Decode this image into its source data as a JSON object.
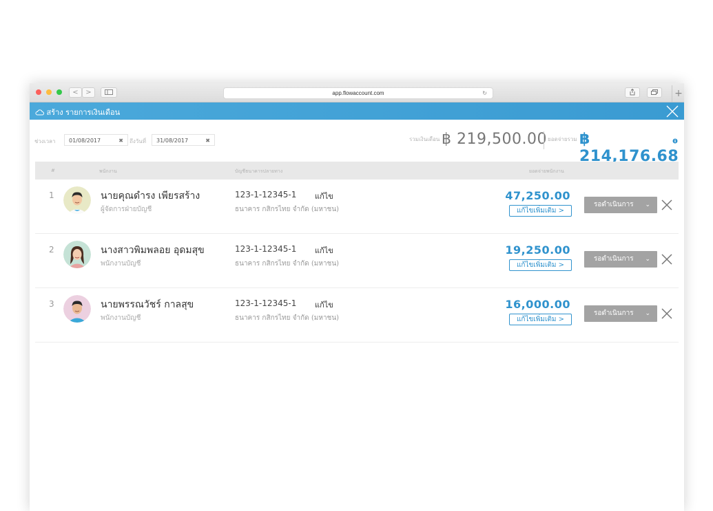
{
  "browser": {
    "url": "app.flowaccount.com",
    "nav_back": "<",
    "nav_forward": ">",
    "colors": {
      "close": "#fc605c",
      "minimize": "#fdbc40",
      "maximize": "#34c84a"
    }
  },
  "app": {
    "title": "สร้าง รายการเงินเดือน"
  },
  "filters": {
    "period_label": "ช่วงเวลา",
    "start_date": "01/08/2017",
    "to_label": "ถึงวันที่",
    "end_date": "31/08/2017"
  },
  "summary": {
    "total_salary_label": "รวมเงินเดือน",
    "total_salary": "฿ 219,500.00",
    "total_pay_label": "ยอดจ่ายรวม",
    "total_pay": "฿ 214,176.68"
  },
  "table": {
    "headers": [
      "#",
      "พนักงาน",
      "บัญชีธนาคารปลายทาง",
      "ยอดจ่ายพนักงาน"
    ],
    "rows": [
      {
        "num": "1",
        "name": "นายคุณดำรง เพียรสร้าง",
        "position": "ผู้จัดการฝ่ายบัญชี",
        "account": "123-1-12345-1",
        "edit": "แก้ไข",
        "bank": "ธนาคาร กสิกรไทย จำกัด (มหาชน)",
        "amount": "47,250.00",
        "more": "แก้ไขเพิ่มเติม >",
        "status": "รอดำเนินการ"
      },
      {
        "num": "2",
        "name": "นางสาวพิมพลอย อุดมสุข",
        "position": "พนักงานบัญชี",
        "account": "123-1-12345-1",
        "edit": "แก้ไข",
        "bank": "ธนาคาร กสิกรไทย จำกัด (มหาชน)",
        "amount": "19,250.00",
        "more": "แก้ไขเพิ่มเติม >",
        "status": "รอดำเนินการ"
      },
      {
        "num": "3",
        "name": "นายพรรณวัชร์ กาลสุข",
        "position": "พนักงานบัญชี",
        "account": "123-1-12345-1",
        "edit": "แก้ไข",
        "bank": "ธนาคาร กสิกรไทย จำกัด (มหาชน)",
        "amount": "16,000.00",
        "more": "แก้ไขเพิ่มเติม >",
        "status": "รอดำเนินการ"
      }
    ]
  },
  "colors": {
    "accent": "#2f92cd",
    "header": "#4ba9db",
    "status_button": "#a3a3a3"
  }
}
